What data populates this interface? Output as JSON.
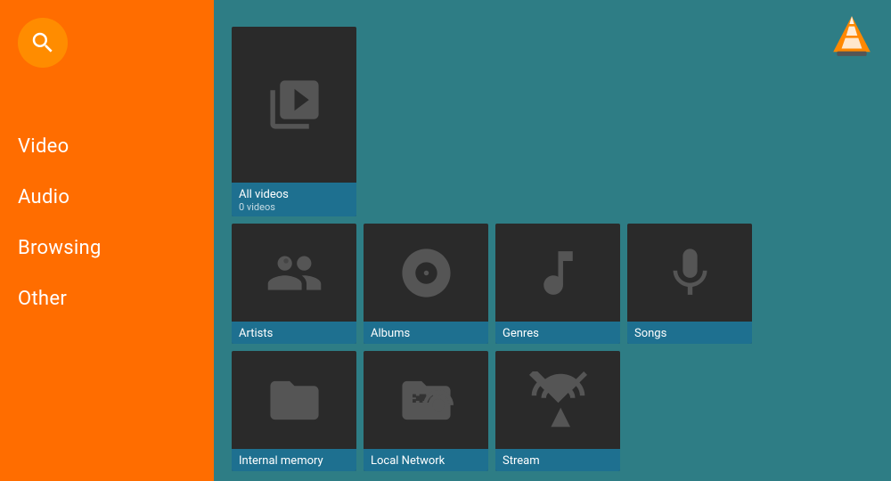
{
  "sidebar": {
    "nav_items": [
      {
        "label": "Video",
        "id": "video"
      },
      {
        "label": "Audio",
        "id": "audio"
      },
      {
        "label": "Browsing",
        "id": "browsing"
      },
      {
        "label": "Other",
        "id": "other"
      }
    ]
  },
  "main": {
    "tiles_row1": [
      {
        "id": "all-videos",
        "label": "All videos",
        "sublabel": "0 videos",
        "icon": "video-stack"
      }
    ],
    "tiles_row2": [
      {
        "id": "artists",
        "label": "Artists",
        "sublabel": "",
        "icon": "artists"
      },
      {
        "id": "albums",
        "label": "Albums",
        "sublabel": "",
        "icon": "albums"
      },
      {
        "id": "genres",
        "label": "Genres",
        "sublabel": "",
        "icon": "genres"
      },
      {
        "id": "songs",
        "label": "Songs",
        "sublabel": "",
        "icon": "songs"
      }
    ],
    "tiles_row3": [
      {
        "id": "internal-memory",
        "label": "Internal memory",
        "sublabel": "",
        "icon": "folder"
      },
      {
        "id": "local-network",
        "label": "Local Network",
        "sublabel": "",
        "icon": "network-folder"
      },
      {
        "id": "stream",
        "label": "Stream",
        "sublabel": "",
        "icon": "stream"
      }
    ]
  }
}
